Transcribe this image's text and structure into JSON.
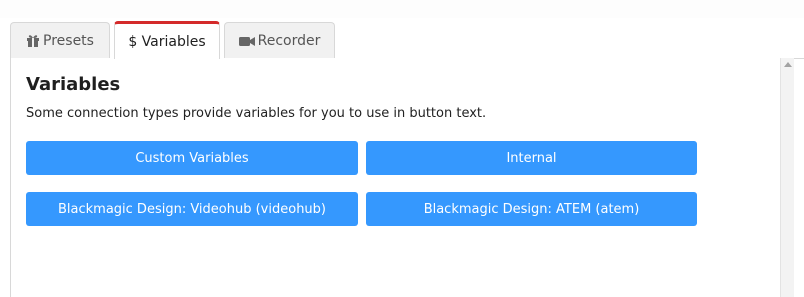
{
  "tabs": [
    {
      "label": "Presets",
      "icon": "gift-icon",
      "active": false
    },
    {
      "label": "$ Variables",
      "icon": "",
      "active": true
    },
    {
      "label": "Recorder",
      "icon": "video-camera-icon",
      "active": false
    }
  ],
  "panel": {
    "title": "Variables",
    "description": "Some connection types provide variables for you to use in button text.",
    "buttons": [
      {
        "label": "Custom Variables"
      },
      {
        "label": "Internal"
      },
      {
        "label": "Blackmagic Design: Videohub (videohub)"
      },
      {
        "label": "Blackmagic Design: ATEM (atem)"
      }
    ]
  },
  "colors": {
    "accent": "#3598fe",
    "active_tab_border": "#d42a2a"
  }
}
